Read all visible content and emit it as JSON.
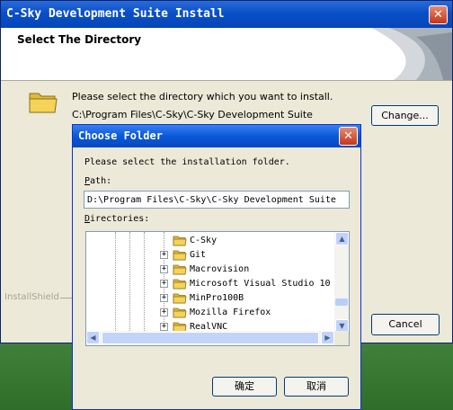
{
  "installer": {
    "title": "C-Sky Development Suite Install",
    "header_title": "Select The Directory",
    "message": "Please select the directory which you want to install.",
    "install_path": "C:\\Program Files\\C-Sky\\C-Sky Development Suite",
    "change_label": "Change...",
    "cancel_label": "Cancel",
    "brand": "InstallShield"
  },
  "dialog": {
    "title": "Choose Folder",
    "prompt": "Please select the installation folder.",
    "path_label_first": "P",
    "path_label_rest": "ath:",
    "path_value": "D:\\Program Files\\C-Sky\\C-Sky Development Suite",
    "dirs_label_first": "D",
    "dirs_label_rest": "irectories:",
    "ok_label": "确定",
    "cancel_label": "取消",
    "close_glyph": "✕"
  },
  "directories": [
    {
      "name": "C-Sky",
      "expander": ""
    },
    {
      "name": "Git",
      "expander": "+"
    },
    {
      "name": "Macrovision",
      "expander": "+"
    },
    {
      "name": "Microsoft Visual Studio 10",
      "expander": "+"
    },
    {
      "name": "MinPro100B",
      "expander": "+"
    },
    {
      "name": "Mozilla Firefox",
      "expander": "+"
    },
    {
      "name": "RealVNC",
      "expander": "+"
    }
  ],
  "icons": {
    "folder": "folder-icon",
    "close": "close-icon",
    "scroll_up": "chevron-up-icon",
    "scroll_down": "chevron-down-icon",
    "scroll_left": "chevron-left-icon",
    "scroll_right": "chevron-right-icon"
  },
  "colors": {
    "titlebar_blue": "#0a4fc8",
    "window_bg": "#ece9d8",
    "close_red": "#c4361a",
    "folder_yellow": "#f5d35a"
  }
}
